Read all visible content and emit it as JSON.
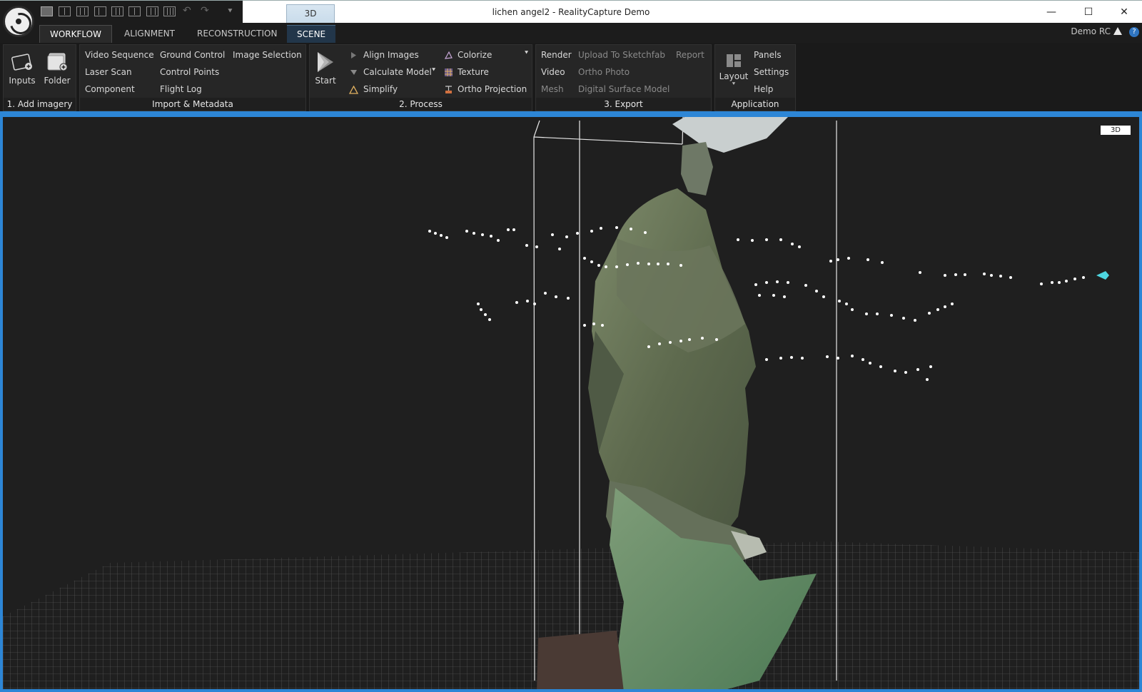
{
  "window": {
    "title": "lichen angel2 - RealityCapture Demo",
    "minimize_glyph": "—",
    "maximize_glyph": "☐",
    "close_glyph": "✕"
  },
  "quick_access": {
    "view_tab_label": "3D",
    "icons": [
      "layout-1-icon",
      "layout-2-icon",
      "layout-3-icon",
      "layout-4-icon",
      "layout-5-icon",
      "layout-6-icon",
      "layout-7-icon",
      "layout-8-icon",
      "undo-icon",
      "redo-icon"
    ],
    "undo_glyph": "↶",
    "redo_glyph": "↷",
    "customize_glyph": "⯆"
  },
  "tabs": [
    {
      "label": "WORKFLOW",
      "active": true
    },
    {
      "label": "ALIGNMENT",
      "active": false
    },
    {
      "label": "RECONSTRUCTION",
      "active": false
    },
    {
      "label": "SCENE",
      "active": false
    }
  ],
  "account": {
    "user": "Demo RC",
    "help_glyph": "?"
  },
  "ribbon": {
    "add_imagery": {
      "label": "1. Add imagery",
      "inputs": "Inputs",
      "folder": "Folder"
    },
    "import_metadata": {
      "label": "Import & Metadata",
      "items": [
        "Video Sequence",
        "Ground Control",
        "Image Selection",
        "Laser Scan",
        "Control Points",
        "Component",
        "Flight Log"
      ]
    },
    "process": {
      "label": "2. Process",
      "start": "Start",
      "align": "Align Images",
      "calculate": "Calculate Model",
      "simplify": "Simplify",
      "colorize": "Colorize",
      "texture": "Texture",
      "ortho": "Ortho Projection"
    },
    "export": {
      "label": "3. Export",
      "render": "Render",
      "upload": "Upload To Sketchfab",
      "report": "Report",
      "video": "Video",
      "ortho_photo": "Ortho Photo",
      "mesh": "Mesh",
      "dsm": "Digital Surface Model"
    },
    "application": {
      "label": "Application",
      "layout": "Layout",
      "panels": "Panels",
      "settings": "Settings",
      "help": "Help"
    }
  },
  "viewport": {
    "badge": "3D",
    "accent": "#2d86d6"
  }
}
